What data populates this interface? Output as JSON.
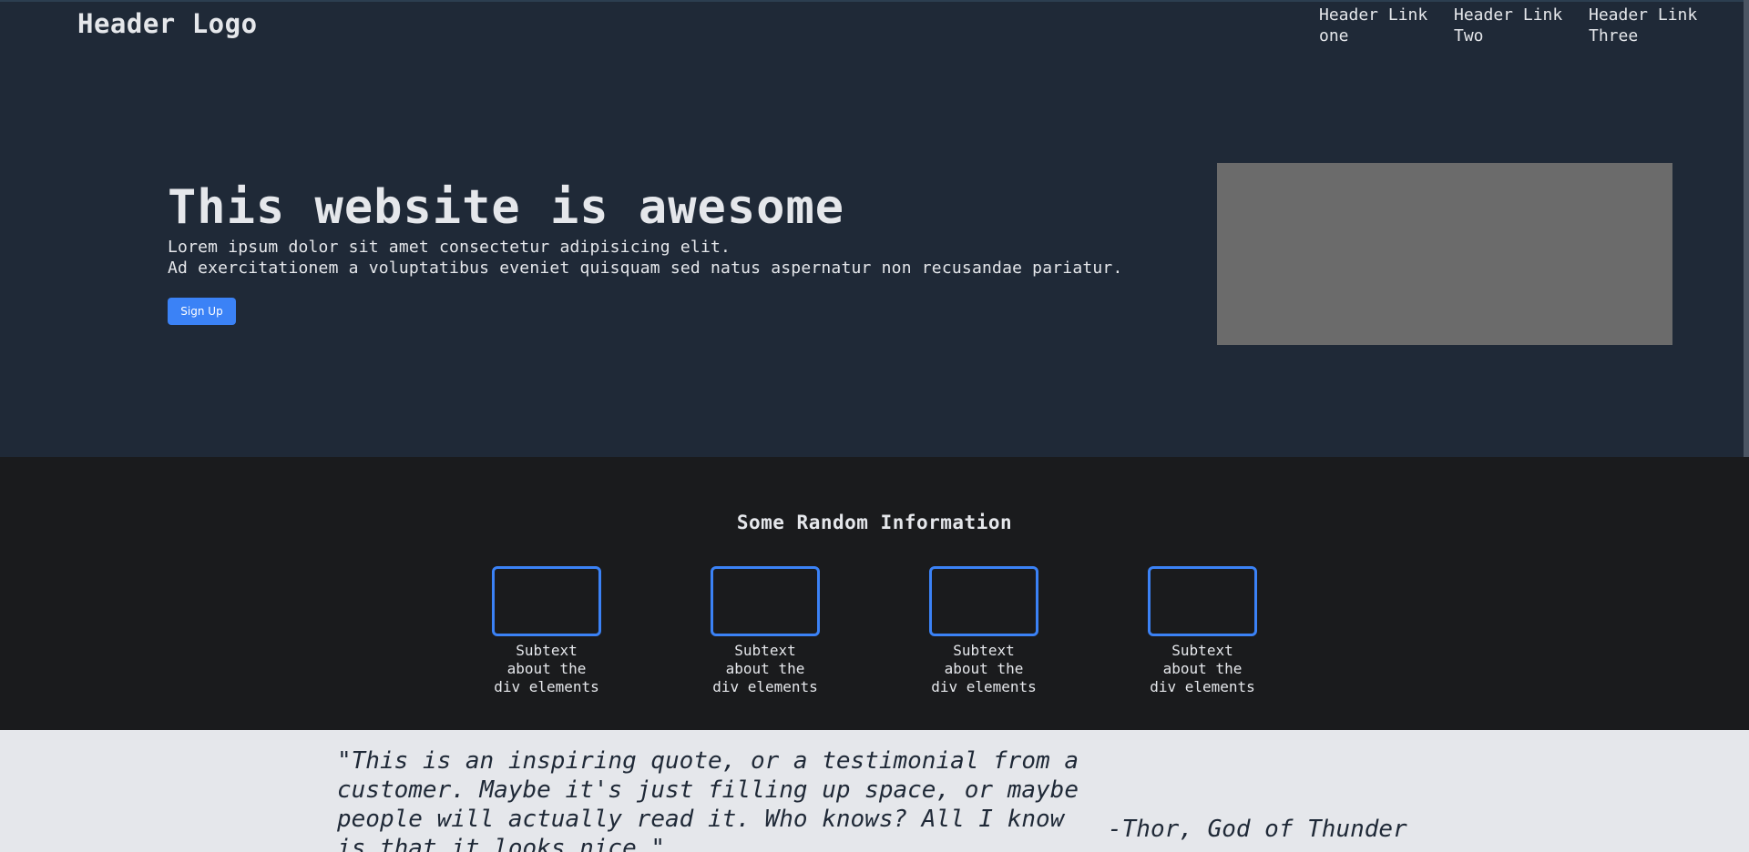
{
  "header": {
    "logo": "Header Logo",
    "links": [
      "Header Link one",
      "Header Link Two",
      "Header Link Three"
    ]
  },
  "hero": {
    "title": "This website is awesome",
    "line1": "Lorem ipsum dolor sit amet consectetur adipisicing elit.",
    "line2": "Ad exercitationem a voluptatibus eveniet quisquam sed natus aspernatur non recusandae pariatur.",
    "signup_label": "Sign Up"
  },
  "info": {
    "title": "Some Random Information",
    "cards": [
      {
        "text": "Subtext about the div elements"
      },
      {
        "text": "Subtext about the div elements"
      },
      {
        "text": "Subtext about the div elements"
      },
      {
        "text": "Subtext about the div elements"
      }
    ]
  },
  "quote": {
    "text": "\"This is an inspiring quote, or a testimonial from a customer. Maybe it's just filling up space, or maybe people will actually read it. Who knows? All I know is that it looks nice.\"",
    "author": "-Thor, God of Thunder"
  },
  "colors": {
    "hero_bg": "#1f2937",
    "info_bg": "#1a1b1d",
    "quote_bg": "#e5e7eb",
    "accent": "#3b82f6",
    "image_placeholder": "#6b6b6b"
  }
}
